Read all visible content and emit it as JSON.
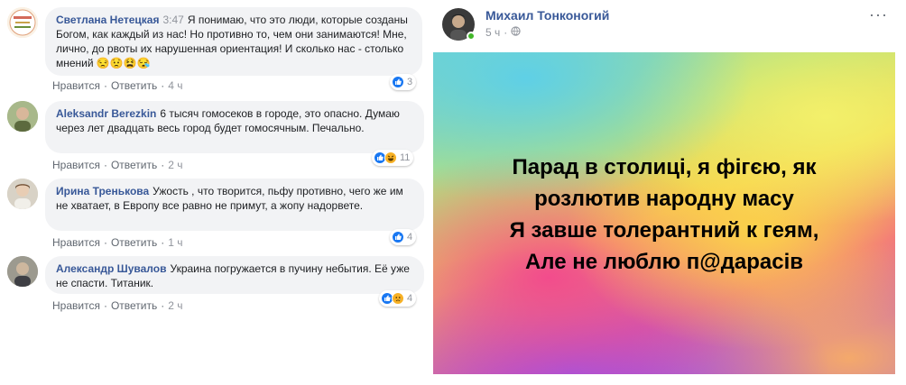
{
  "comments": [
    {
      "author": "Светлана Нетецкая",
      "time_inline": "3:47",
      "text": "Я понимаю, что это люди, которые созданы Богом, как каждый из нас! Но противно то, чем они занимаются! Мне, лично, до рвоты их нарушенная ориентация! И сколько нас - столько мнений 😒😟😫😪",
      "like_label": "Нравится",
      "reply_label": "Ответить",
      "age": "4 ч",
      "reaction_count": "3",
      "reactions": [
        "like"
      ]
    },
    {
      "author": "Aleksandr Berezkin",
      "text": "6 тысяч гомосеков в городе, это опасно. Думаю через лет двадцать весь город будет гомосячным. Печально.",
      "like_label": "Нравится",
      "reply_label": "Ответить",
      "age": "2 ч",
      "reaction_count": "11",
      "reactions": [
        "like",
        "haha"
      ]
    },
    {
      "author": "Ирина Тренькова",
      "text": "Ужость , что творится, пьфу противно, чего же им не хватает, в Европу все равно не примут, а жопу надорвете.",
      "like_label": "Нравится",
      "reply_label": "Ответить",
      "age": "1 ч",
      "reaction_count": "4",
      "reactions": [
        "like"
      ]
    },
    {
      "author": "Александр Шувалов",
      "text": "Украина погружается в пучину небытия. Её уже не спасти. Титаник.",
      "like_label": "Нравится",
      "reply_label": "Ответить",
      "age": "2 ч",
      "reaction_count": "4",
      "reactions": [
        "like",
        "sad"
      ]
    }
  ],
  "post": {
    "author": "Михаил Тонконогий",
    "time": "5 ч",
    "more_label": "···",
    "text_lines": [
      "Парад в столиці, я фігєю, як",
      "розлютив народну масу",
      "Я завше толерантний к геям,",
      "Але не люблю п@дарасів"
    ]
  },
  "colors": {
    "link": "#385898",
    "bubble": "#f2f3f5",
    "like": "#1877f2"
  }
}
